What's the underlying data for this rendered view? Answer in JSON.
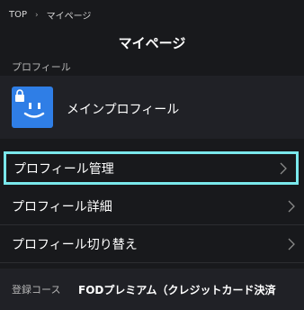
{
  "breadcrumb": {
    "home": "TOP",
    "current": "マイページ"
  },
  "page": {
    "title": "マイページ"
  },
  "profile_section": {
    "label": "プロフィール"
  },
  "profile": {
    "name": "メインプロフィール",
    "avatar_color": "#2f7ee6"
  },
  "menu": {
    "items": [
      {
        "label": "プロフィール管理"
      },
      {
        "label": "プロフィール詳細"
      },
      {
        "label": "プロフィール切り替え"
      }
    ]
  },
  "course": {
    "label": "登録コース",
    "value": "FODプレミアム（クレジットカード決済"
  },
  "colors": {
    "background": "#18191c",
    "panel": "#202126",
    "focus_ring": "#7ae8ec"
  },
  "icons": [
    "chevron-right-icon",
    "lock-icon",
    "smiley-avatar-icon"
  ]
}
